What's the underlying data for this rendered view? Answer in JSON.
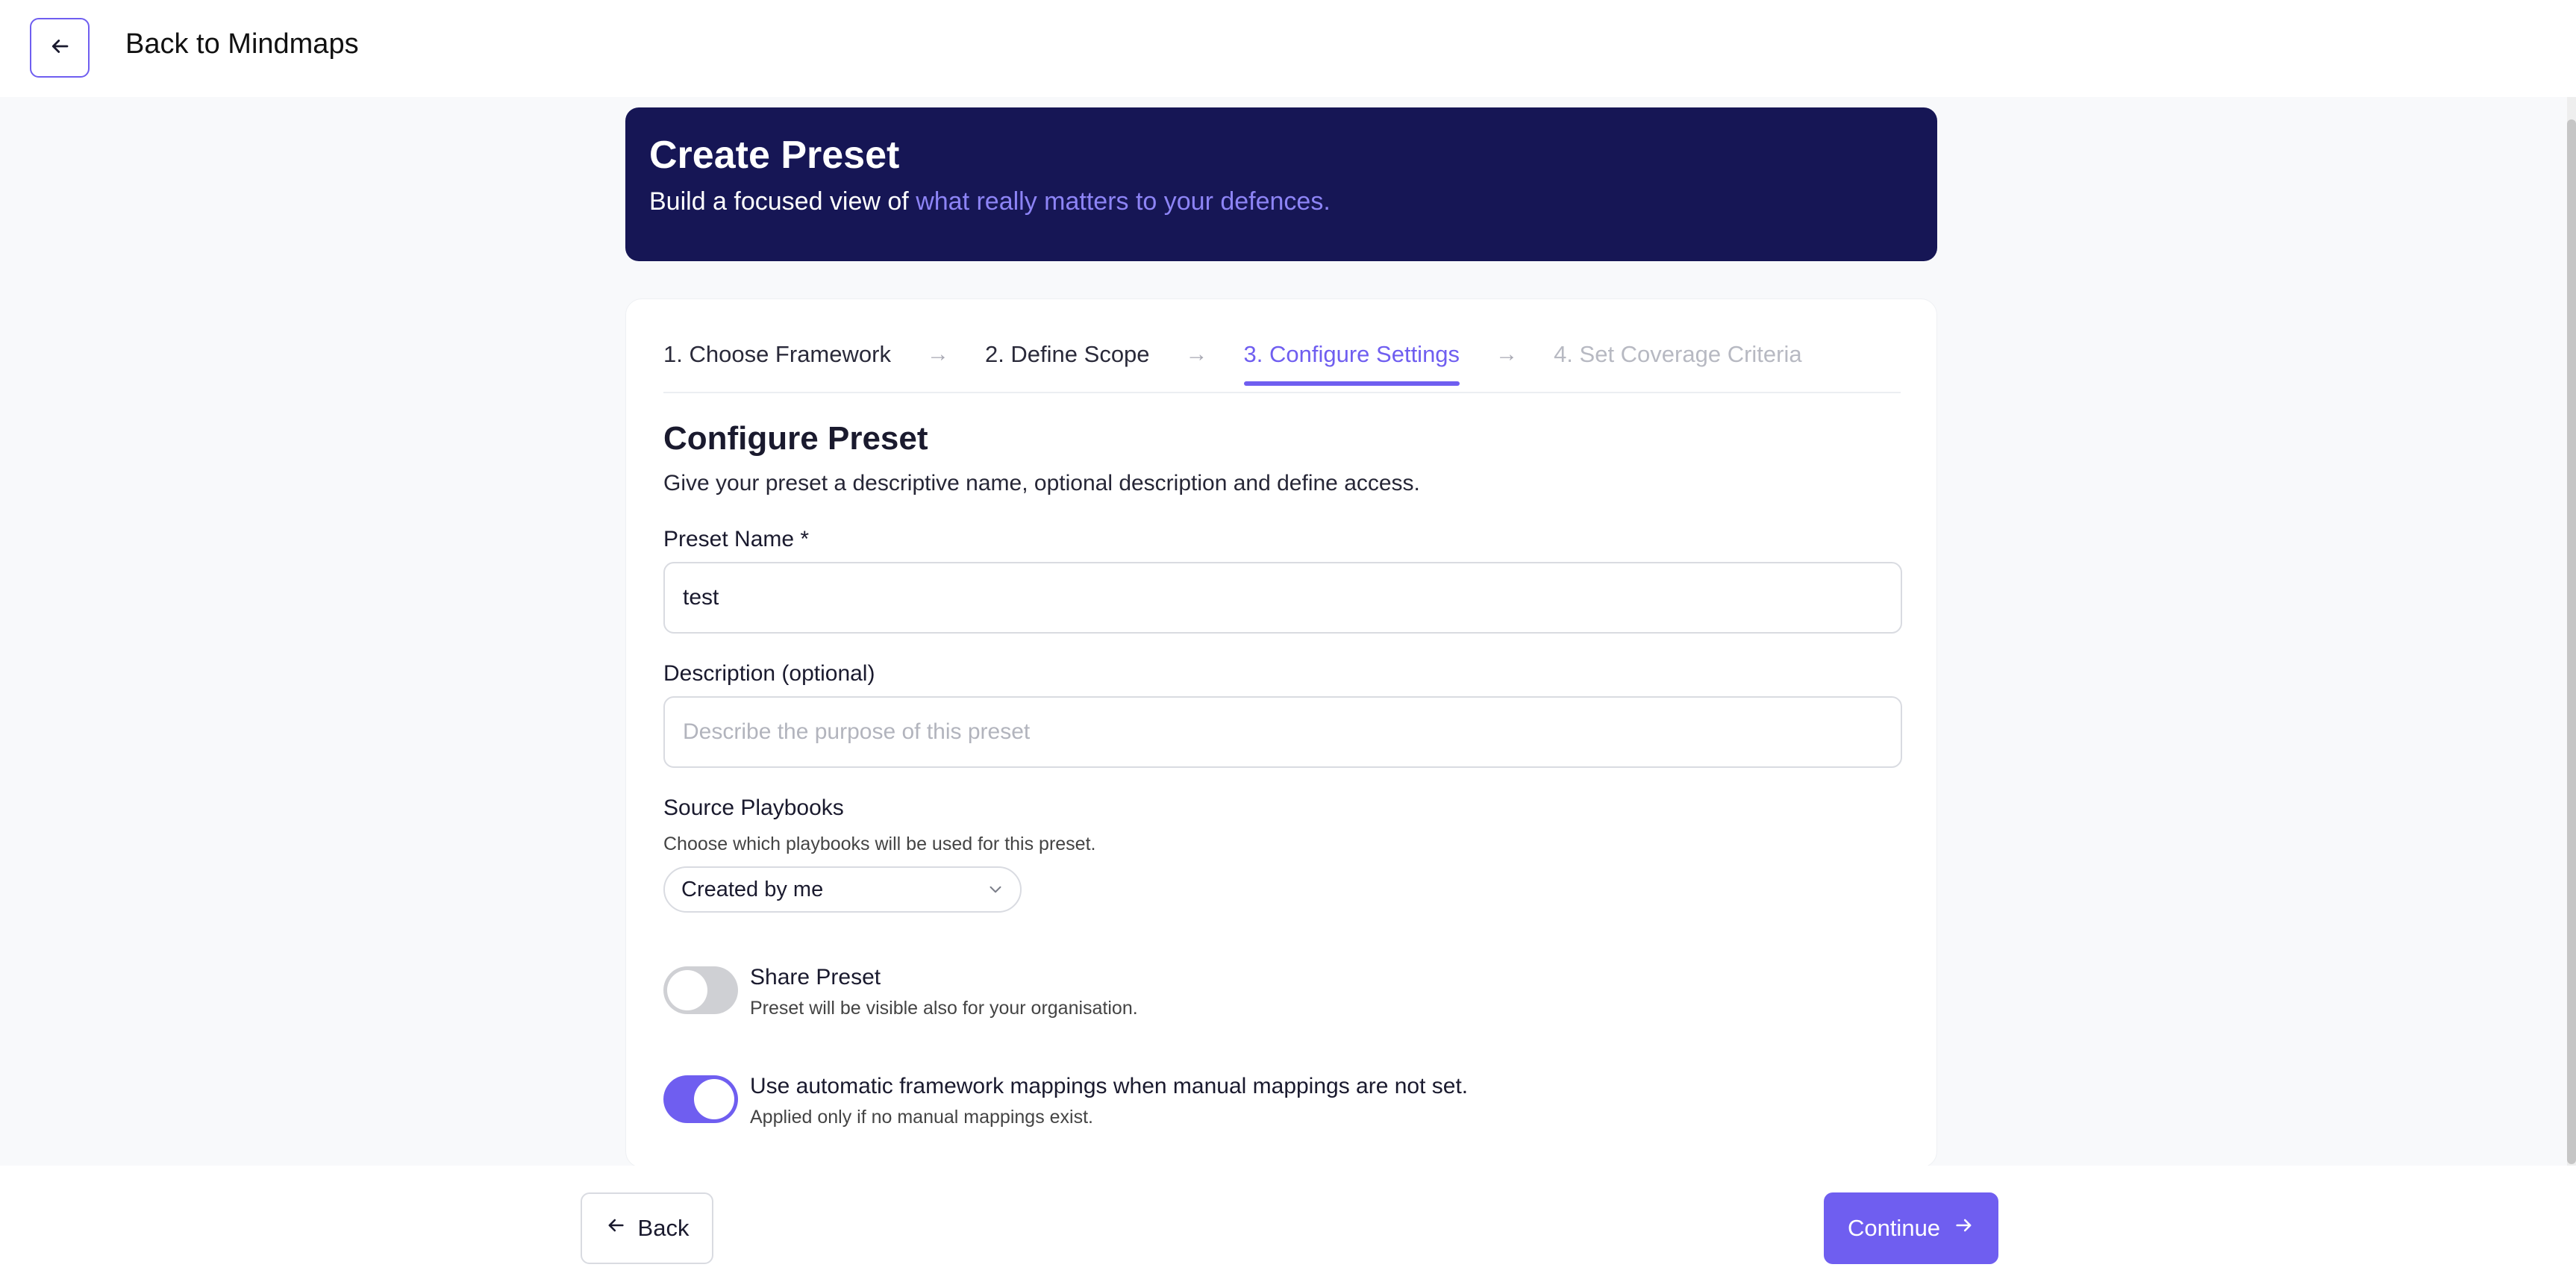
{
  "topbar": {
    "title": "Back to Mindmaps"
  },
  "hero": {
    "title": "Create Preset",
    "subtitle_plain": "Build a focused view of ",
    "subtitle_accent": "what really matters to your defences."
  },
  "steps": [
    {
      "label": "1. Choose Framework",
      "state": "done"
    },
    {
      "label": "2. Define Scope",
      "state": "done"
    },
    {
      "label": "3. Configure Settings",
      "state": "active"
    },
    {
      "label": "4. Set Coverage Criteria",
      "state": "disabled"
    }
  ],
  "form": {
    "title": "Configure Preset",
    "subtitle": "Give your preset a descriptive name, optional description and define access.",
    "name_label": "Preset Name *",
    "name_value": "test",
    "description_label": "Description (optional)",
    "description_placeholder": "Describe the purpose of this preset",
    "playbooks_label": "Source Playbooks",
    "playbooks_helper": "Choose which playbooks will be used for this preset.",
    "playbooks_selected": "Created by me",
    "share": {
      "title": "Share Preset",
      "subtitle": "Preset will be visible also for your organisation.",
      "enabled": false
    },
    "auto_mapping": {
      "title": "Use automatic framework mappings when manual mappings are not set.",
      "subtitle": "Applied only if no manual mappings exist.",
      "enabled": true
    }
  },
  "footer": {
    "back_label": "Back",
    "continue_label": "Continue"
  },
  "colors": {
    "accent": "#6f5ef0",
    "hero_bg": "#161655"
  },
  "icons": [
    "arrow-left-icon",
    "arrow-right-icon",
    "chevron-down-icon"
  ]
}
